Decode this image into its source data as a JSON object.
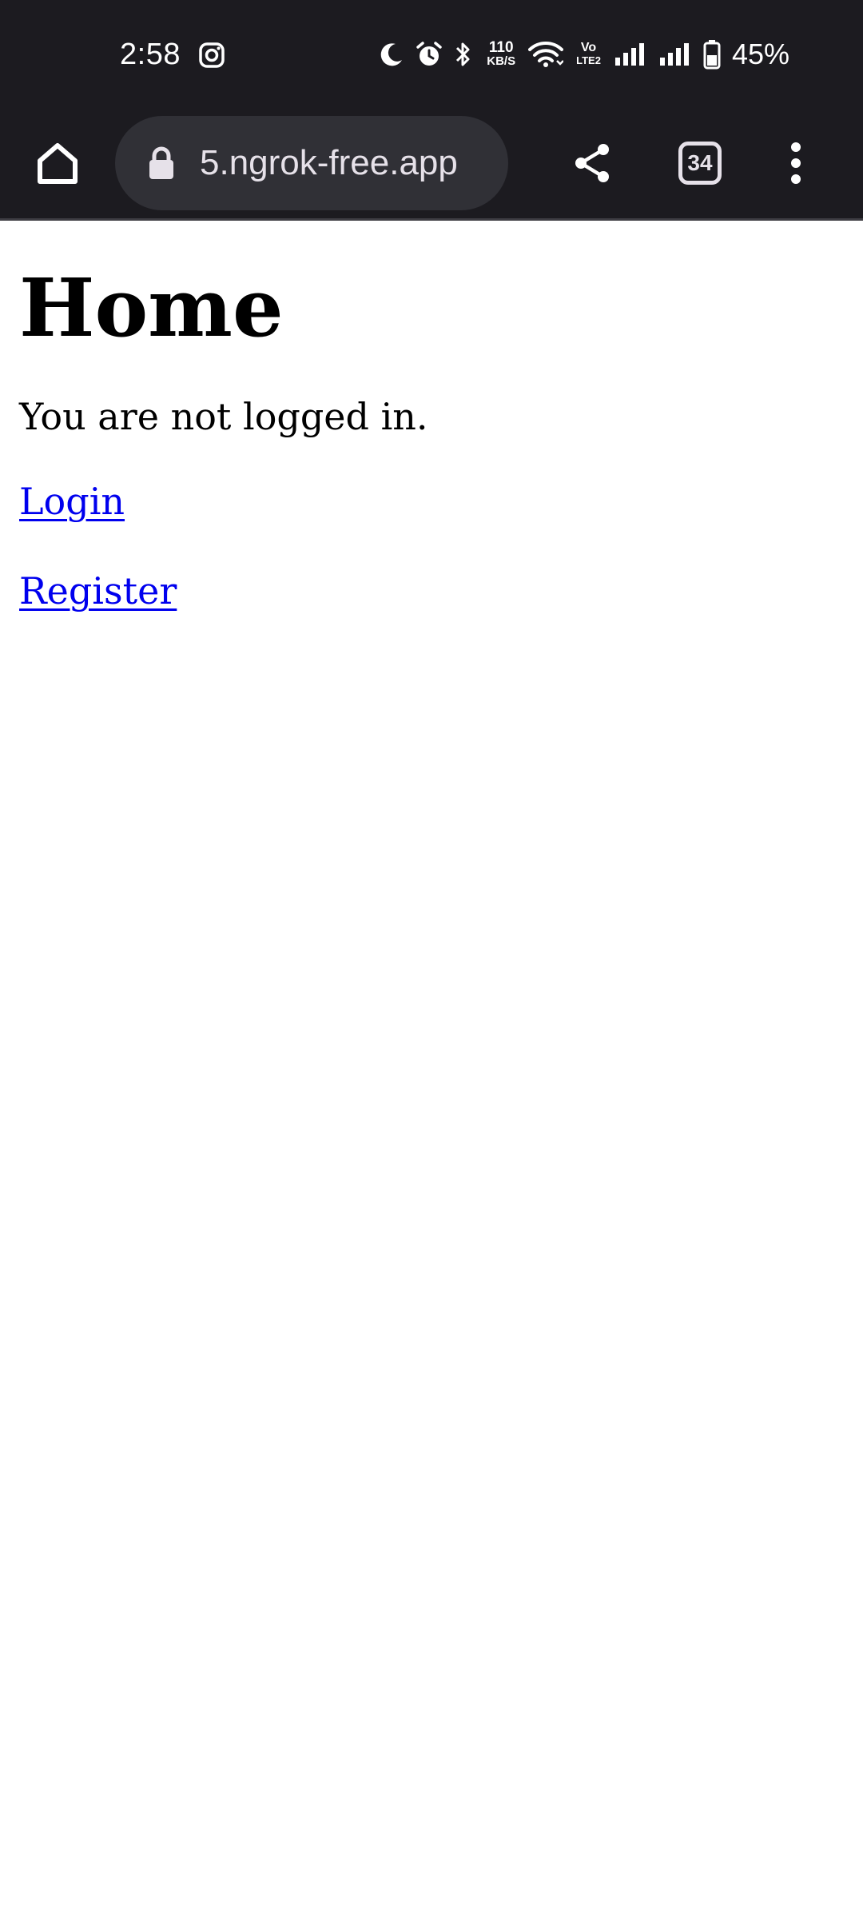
{
  "status_bar": {
    "time": "2:58",
    "net_speed_value": "110",
    "net_speed_unit": "KB/S",
    "volte_label_top": "Vo",
    "volte_label_bottom": "LTE2",
    "battery_percent": "45%",
    "icons": [
      "instagram-icon",
      "moon-icon",
      "alarm-icon",
      "bluetooth-icon",
      "wifi-icon",
      "volte-icon",
      "signal-icon",
      "signal-icon",
      "battery-icon"
    ]
  },
  "browser": {
    "url": "5.ngrok-free.app",
    "tab_count": "34",
    "icons": [
      "home-icon",
      "lock-icon",
      "share-icon",
      "tab-switcher-icon",
      "overflow-menu-icon"
    ]
  },
  "page": {
    "title": "Home",
    "message": "You are not logged in.",
    "links": {
      "login": "Login",
      "register": "Register"
    },
    "link_color": "#0000ee"
  },
  "colors": {
    "chrome_background": "#1c1b20",
    "omnibox_background": "#303036",
    "page_background": "#ffffff"
  }
}
